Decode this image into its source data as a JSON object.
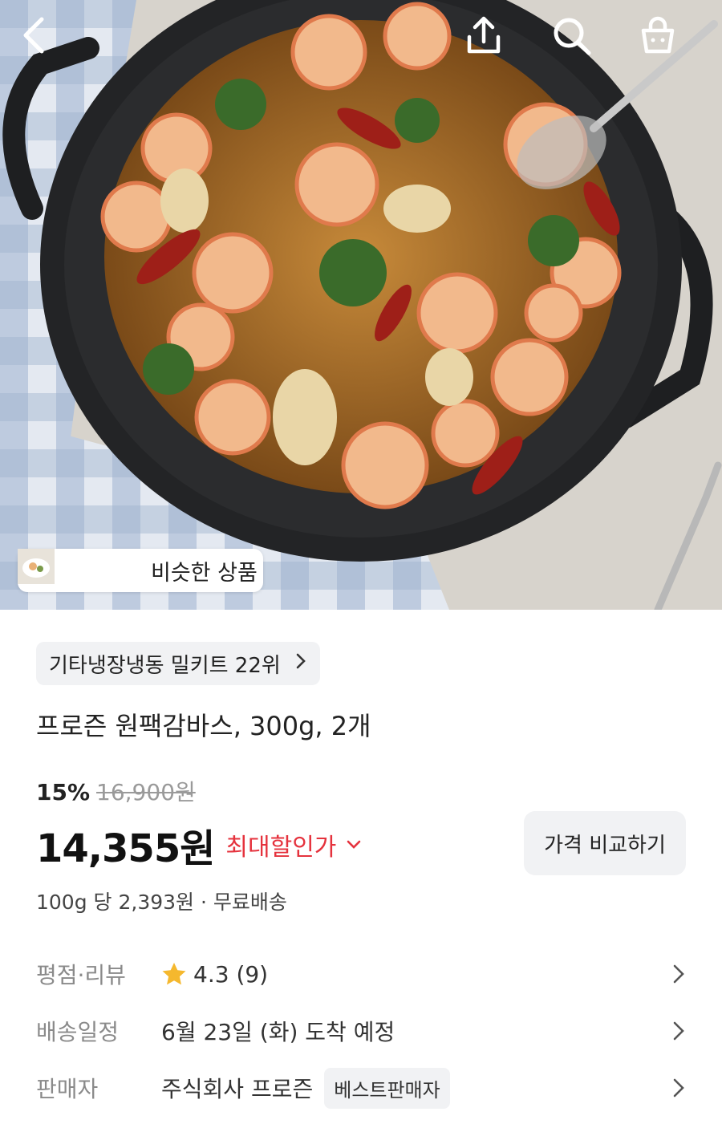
{
  "hero": {
    "similar_label": "비슷한 상품"
  },
  "icons": {
    "back": "chevron-left-icon",
    "share": "share-icon",
    "search": "search-icon",
    "cart": "shopping-bag-icon"
  },
  "product": {
    "rank_label": "기타냉장냉동 밀키트 22위",
    "title": "프로즌 원팩감바스, 300g, 2개",
    "discount_percent": "15%",
    "original_price": "16,900원",
    "price": "14,355원",
    "max_discount_label": "최대할인가",
    "compare_button": "가격 비교하기",
    "unit_price": "100g 당 2,393원",
    "shipping": "무료배송"
  },
  "info": {
    "rating_key": "평점·리뷰",
    "rating_value": "4.3",
    "review_count": "(9)",
    "delivery_key": "배송일정",
    "delivery_value": "6월 23일 (화) 도착 예정",
    "seller_key": "판매자",
    "seller_value": "주식회사 프로즌",
    "seller_badge": "베스트판매자"
  },
  "colors": {
    "accent_red": "#e5323d",
    "star": "#f5b82e",
    "chip_bg": "#f1f2f4"
  }
}
